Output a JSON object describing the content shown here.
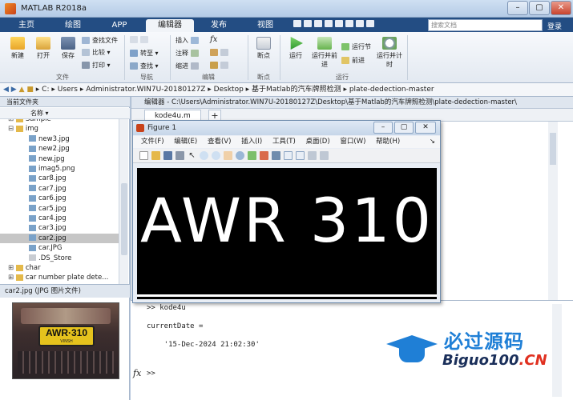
{
  "window": {
    "title": "MATLAB R2018a"
  },
  "tabs": [
    {
      "label": "主页"
    },
    {
      "label": "绘图"
    },
    {
      "label": "APP"
    },
    {
      "label": "编辑器"
    },
    {
      "label": "发布"
    },
    {
      "label": "视图"
    }
  ],
  "search": {
    "placeholder": "搜索文档"
  },
  "login": "登录",
  "ribbon": {
    "file": {
      "new": "新建",
      "open": "打开",
      "save": "保存",
      "find_files": "查找文件",
      "compare": "比较",
      "print": "打印",
      "group": "文件"
    },
    "nav": {
      "goto": "转至",
      "find": "查找",
      "group": "导航"
    },
    "edit": {
      "insert": "插入",
      "comment": "注释",
      "indent": "缩进",
      "fx": "fx",
      "group": "编辑"
    },
    "breakpoints": {
      "bp": "断点",
      "group": "断点"
    },
    "run": {
      "run": "运行",
      "run_advance": "运行并前进",
      "run_section": "运行节",
      "advance": "前进",
      "run_time": "运行并计时",
      "group": "运行"
    }
  },
  "address": {
    "path": [
      "C:",
      "Users",
      "Administrator.WIN7U-20180127Z",
      "Desktop",
      "基于Matlab的汽车牌照检测",
      "plate-dedection-master"
    ]
  },
  "filepanel": {
    "header": "当前文件夹",
    "col_name": "名称",
    "rows": [
      {
        "label": "Sample",
        "kind": "folder"
      },
      {
        "label": "img",
        "kind": "folder-open"
      },
      {
        "label": "new3.jpg",
        "kind": "img"
      },
      {
        "label": "new2.jpg",
        "kind": "img"
      },
      {
        "label": "new.jpg",
        "kind": "img"
      },
      {
        "label": "imag5.png",
        "kind": "img"
      },
      {
        "label": "car8.jpg",
        "kind": "img"
      },
      {
        "label": "car7.jpg",
        "kind": "img"
      },
      {
        "label": "car6.jpg",
        "kind": "img"
      },
      {
        "label": "car5.jpg",
        "kind": "img"
      },
      {
        "label": "car4.jpg",
        "kind": "img"
      },
      {
        "label": "car3.jpg",
        "kind": "img"
      },
      {
        "label": "car2.jpg",
        "kind": "img",
        "selected": true
      },
      {
        "label": "car.JPG",
        "kind": "img"
      },
      {
        "label": ".DS_Store",
        "kind": "file"
      },
      {
        "label": "char",
        "kind": "folder"
      },
      {
        "label": "car number plate dete...",
        "kind": "folder"
      }
    ]
  },
  "details": {
    "header": "car2.jpg  (JPG 图片文件)",
    "plate_text": "AWR·310",
    "plate_sub": "VINSH"
  },
  "editor": {
    "title": "编辑器 - C:\\Users\\Administrator.WIN7U-20180127Z\\Desktop\\基于Matlab的汽车牌照检测\\plate-dedection-master\\",
    "tab": "kode4u.m",
    "add": "+"
  },
  "figure": {
    "title": "Figure 1",
    "menu": [
      "文件(F)",
      "编辑(E)",
      "查看(V)",
      "插入(I)",
      "工具(T)",
      "桌面(D)",
      "窗口(W)",
      "帮助(H)"
    ],
    "plate_text": "AWR 310"
  },
  "command": {
    "lines": [
      ">> kode4u",
      "",
      "currentDate =",
      "",
      "    '15-Dec-2024 21:02:30'",
      "",
      ""
    ],
    "prompt": ">>",
    "fx": "fx"
  },
  "watermark": {
    "cn": "必过源码",
    "en": "Biguo100",
    "tld": ".CN",
    "colors": {
      "cn": "#1f7fd6",
      "tld": "#e03020"
    }
  }
}
